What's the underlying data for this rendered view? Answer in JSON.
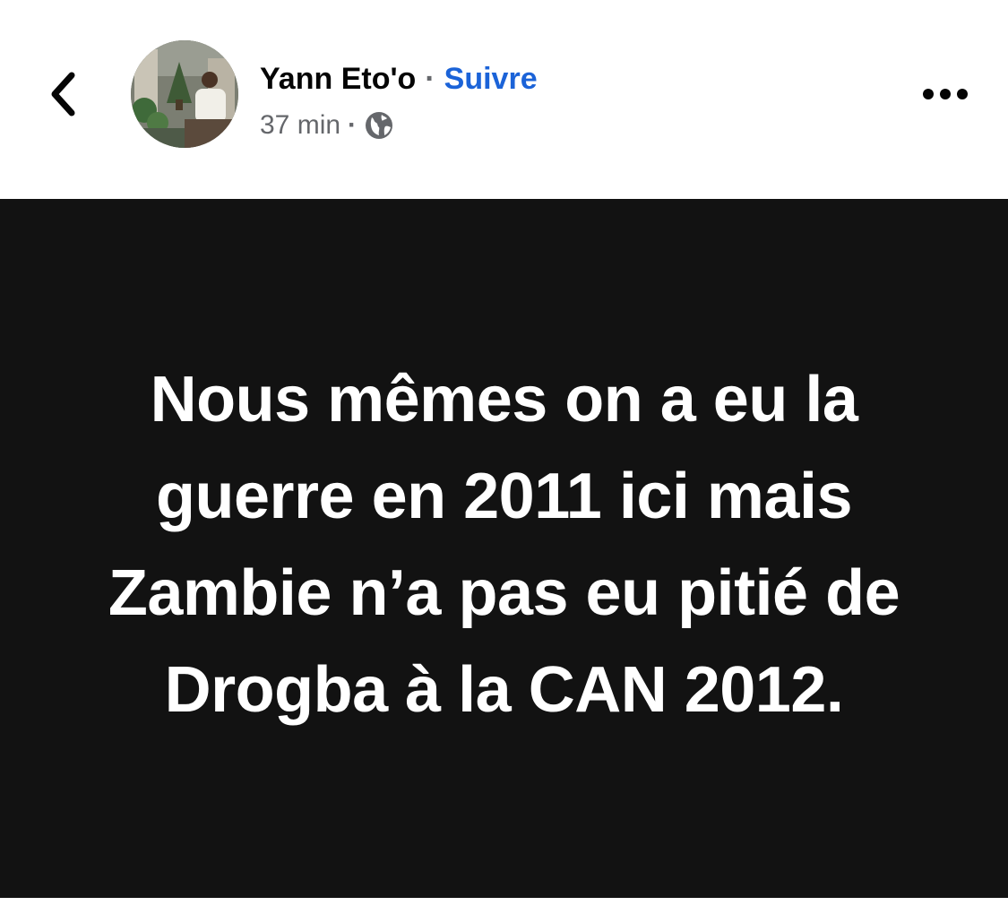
{
  "header": {
    "author_name": "Yann Eto'o",
    "separator": "·",
    "follow_label": "Suivre",
    "timestamp": "37 min",
    "meta_separator": "·",
    "privacy_icon": "globe-icon",
    "back_icon": "chevron-left-icon",
    "more_icon": "more-horizontal-icon"
  },
  "post": {
    "text": "Nous mêmes on a eu la guerre en 2011 ici mais Zambie n’a pas eu pitié de Drogba à la CAN 2012.",
    "background_color": "#121212",
    "text_color": "#ffffff"
  },
  "colors": {
    "accent": "#1b63d8",
    "secondary_text": "#65676b"
  }
}
